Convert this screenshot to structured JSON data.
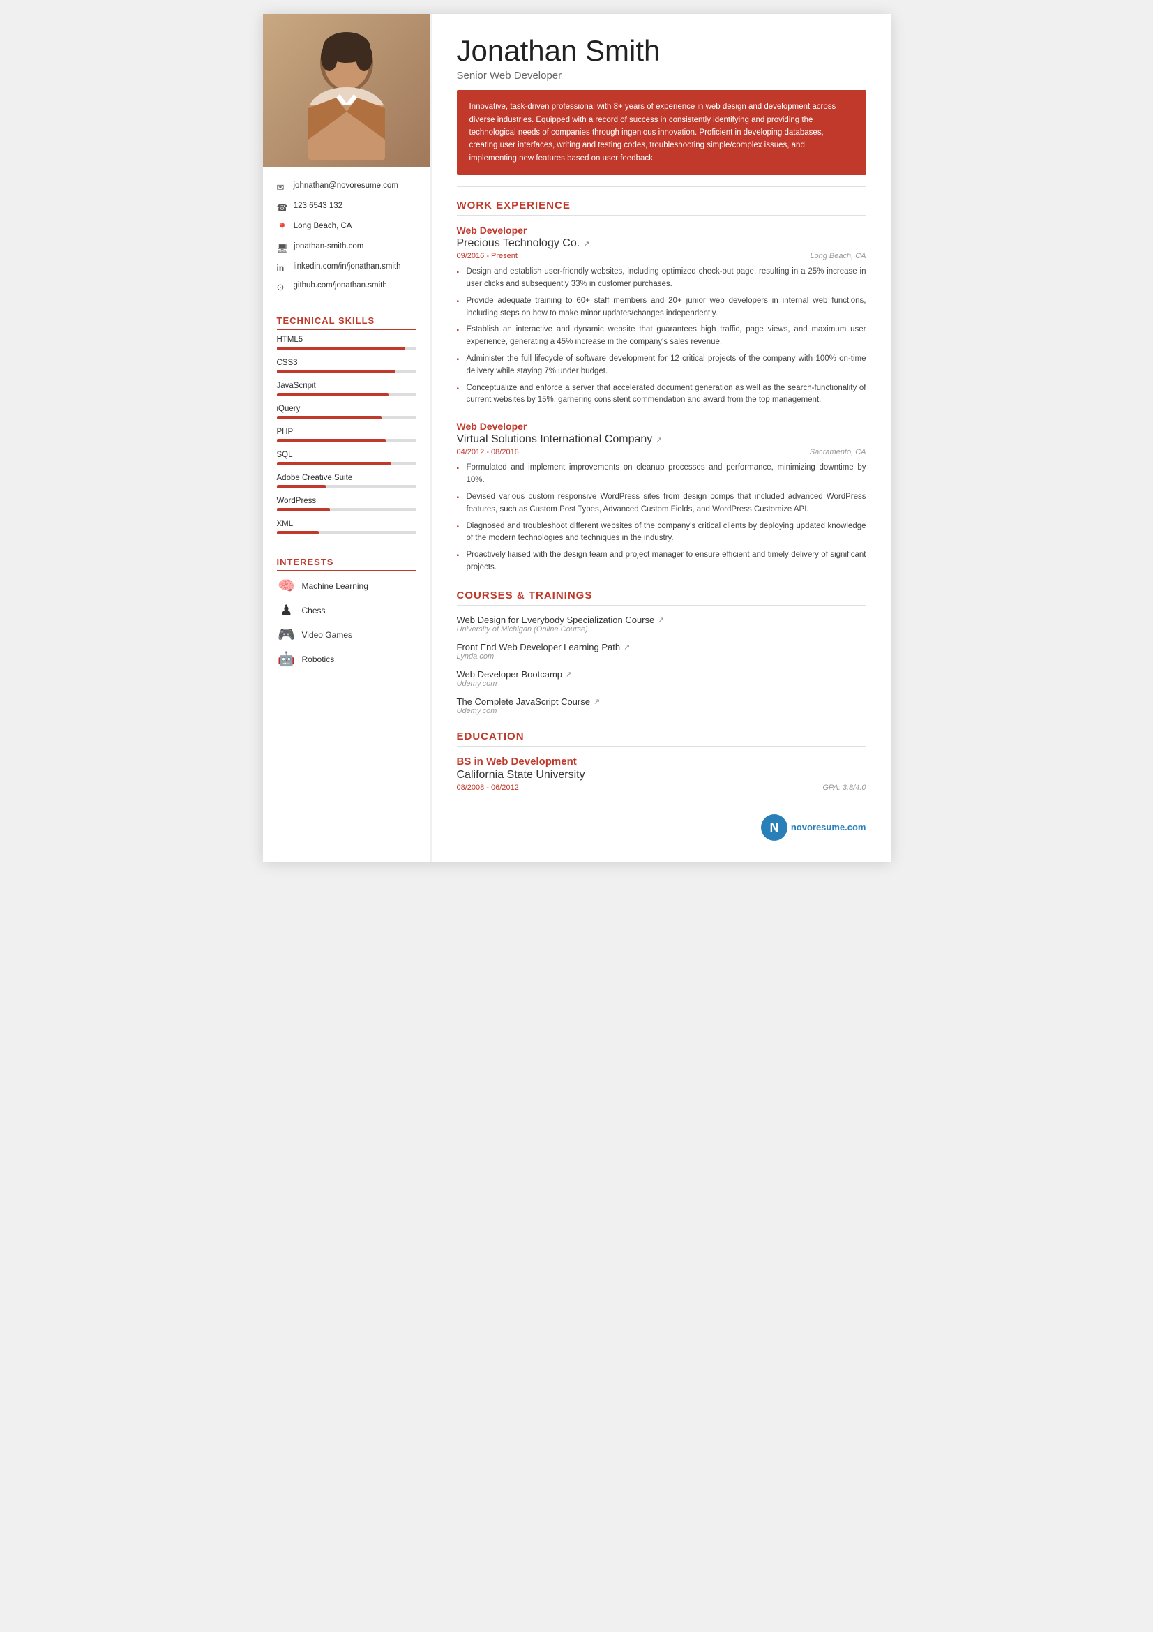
{
  "person": {
    "name": "Jonathan Smith",
    "title": "Senior Web Developer",
    "summary": "Innovative, task-driven professional with 8+ years of experience in web design and development across diverse industries. Equipped with a record of success in consistently identifying and providing the technological needs of companies through ingenious innovation. Proficient in developing databases, creating user interfaces, writing and testing codes, troubleshooting simple/complex issues, and implementing new features based on user feedback.",
    "email": "johnathan@novoresume.com",
    "phone": "123 6543 132",
    "location": "Long Beach, CA",
    "website": "jonathan-smith.com",
    "linkedin": "linkedin.com/in/jonathan.smith",
    "github": "github.com/jonathan.smith"
  },
  "technicalSkills": {
    "sectionTitle": "TECHNICAL SKILLS",
    "skills": [
      {
        "name": "HTML5",
        "level": 92,
        "class": "skill-html5"
      },
      {
        "name": "CSS3",
        "level": 85,
        "class": "skill-css3"
      },
      {
        "name": "JavaScripit",
        "level": 80,
        "class": "skill-javascript"
      },
      {
        "name": "iQuery",
        "level": 75,
        "class": "skill-jquery"
      },
      {
        "name": "PHP",
        "level": 78,
        "class": "skill-php"
      },
      {
        "name": "SQL",
        "level": 82,
        "class": "skill-sql"
      },
      {
        "name": "Adobe Creative Suite",
        "level": 35,
        "class": "skill-adobe"
      },
      {
        "name": "WordPress",
        "level": 38,
        "class": "skill-wordpress"
      },
      {
        "name": "XML",
        "level": 30,
        "class": "skill-xml"
      }
    ]
  },
  "interests": {
    "sectionTitle": "INTERESTS",
    "items": [
      {
        "name": "Machine Learning",
        "icon": "🧠"
      },
      {
        "name": "Chess",
        "icon": "♟"
      },
      {
        "name": "Video Games",
        "icon": "🎮"
      },
      {
        "name": "Robotics",
        "icon": "🤖"
      }
    ]
  },
  "workExperience": {
    "sectionTitle": "WORK EXPERIENCE",
    "jobs": [
      {
        "title": "Web Developer",
        "company": "Precious Technology Co.",
        "dates": "09/2016 - Present",
        "location": "Long Beach, CA",
        "bullets": [
          "Design and establish user-friendly websites, including optimized check-out page, resulting in a 25% increase in user clicks and subsequently 33% in customer purchases.",
          "Provide adequate training to 60+ staff members and 20+ junior web developers in internal web functions, including steps on how to make minor updates/changes independently.",
          "Establish an interactive and dynamic website that guarantees high traffic, page views, and maximum user experience, generating a 45% increase in the company's sales revenue.",
          "Administer the full lifecycle of software development for 12 critical projects of the company with 100% on-time delivery while staying 7% under budget.",
          "Conceptualize and enforce a server that accelerated document generation as well as the search-functionality of current websites by 15%, garnering consistent commendation and award from the top management."
        ]
      },
      {
        "title": "Web Developer",
        "company": "Virtual Solutions International Company",
        "dates": "04/2012 - 08/2016",
        "location": "Sacramento, CA",
        "bullets": [
          "Formulated and implement improvements on cleanup processes and performance, minimizing downtime by 10%.",
          "Devised various custom responsive WordPress sites from design comps that included advanced WordPress features, such as Custom Post Types, Advanced Custom Fields, and WordPress Customize API.",
          "Diagnosed and troubleshoot different websites of the company's critical clients by deploying updated knowledge of the modern technologies and techniques in the industry.",
          "Proactively liaised with the design team and project manager to ensure efficient and timely delivery of significant projects."
        ]
      }
    ]
  },
  "courses": {
    "sectionTitle": "COURSES & TRAININGS",
    "items": [
      {
        "name": "Web Design for Everybody Specialization Course",
        "provider": "University of Michigan (Online Course)"
      },
      {
        "name": "Front End Web Developer Learning Path",
        "provider": "Lynda.com"
      },
      {
        "name": "Web Developer Bootcamp",
        "provider": "Udemy.com"
      },
      {
        "name": "The Complete JavaScript Course",
        "provider": "Udemy.com"
      }
    ]
  },
  "education": {
    "sectionTitle": "EDUCATION",
    "items": [
      {
        "degree": "BS in Web Development",
        "school": "California State University",
        "dates": "08/2008 - 06/2012",
        "gpa": "GPA: 3.8/4.0"
      }
    ]
  },
  "logo": {
    "text": "novoresume.com",
    "letter": "N"
  }
}
